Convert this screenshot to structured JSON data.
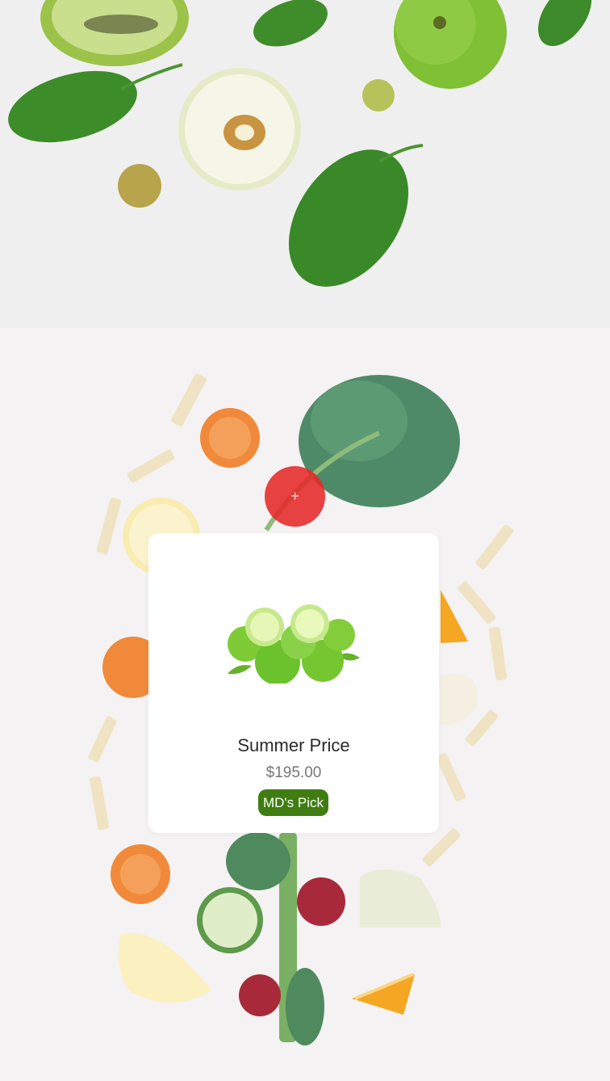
{
  "add_button": {
    "symbol": "+"
  },
  "product": {
    "title": "Summer Price",
    "price": "$195.00",
    "badge": "MD's Pick"
  }
}
